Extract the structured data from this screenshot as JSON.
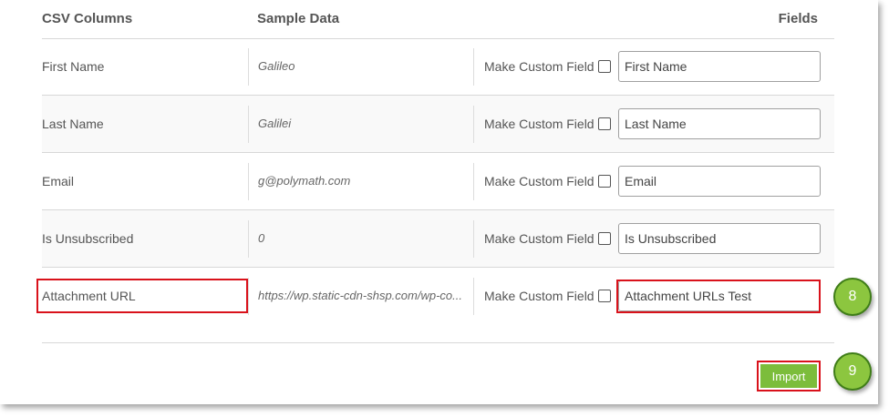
{
  "header": {
    "csv_columns": "CSV Columns",
    "sample_data": "Sample Data",
    "fields": "Fields"
  },
  "rows": [
    {
      "csv_column": "First Name",
      "sample": "Galileo",
      "custom_label": "Make Custom Field",
      "field_value": "First Name",
      "custom_checked": false
    },
    {
      "csv_column": "Last Name",
      "sample": "Galilei",
      "custom_label": "Make Custom Field",
      "field_value": "Last Name",
      "custom_checked": false
    },
    {
      "csv_column": "Email",
      "sample": "g@polymath.com",
      "custom_label": "Make Custom Field",
      "field_value": "Email",
      "custom_checked": false
    },
    {
      "csv_column": "Is Unsubscribed",
      "sample": "0",
      "custom_label": "Make Custom Field",
      "field_value": "Is Unsubscribed",
      "custom_checked": false
    },
    {
      "csv_column": "Attachment URL",
      "sample": "https://wp.static-cdn-shsp.com/wp-co...",
      "custom_label": "Make Custom Field",
      "field_value": "Attachment URLs Test",
      "custom_checked": false
    }
  ],
  "actions": {
    "import_label": "Import"
  },
  "annotations": {
    "step_8": "8",
    "step_9": "9"
  },
  "colors": {
    "highlight": "#d9121b",
    "accent_green": "#7cbd3b",
    "badge_green": "#8cc63f"
  }
}
